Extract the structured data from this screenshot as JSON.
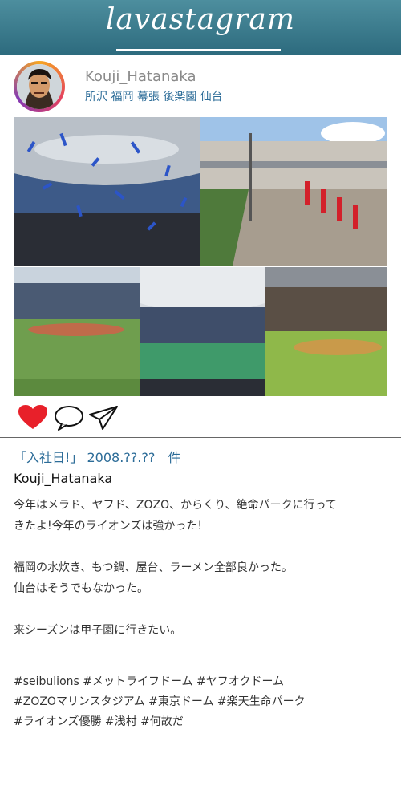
{
  "app": {
    "title": "lavastagram"
  },
  "profile": {
    "username": "Kouji_Hatanaka",
    "locations": "所沢 福岡 幕張 後楽園 仙台"
  },
  "post": {
    "title": "「入社日!」 2008.??.??　件",
    "author": "Kouji_Hatanaka",
    "caption_lines": [
      "今年はメラド、ヤフド、ZOZO、からくり、絶命パークに行って",
      "きたよ!今年のライオンズは強かった!",
      "福岡の水炊き、もつ鍋、屋台、ラーメン全部良かった。",
      "仙台はそうでもなかった。",
      "来シーズンは甲子園に行きたい。"
    ],
    "hashtag_lines": [
      "#seibulions #メットライフドーム #ヤフオクドーム",
      "#ZOZOマリンスタジアム #東京ドーム #楽天生命パーク",
      "#ライオンズ優勝 #浅村 #何故だ"
    ]
  },
  "icons": {
    "like": "heart-icon",
    "comment": "comment-icon",
    "share": "paper-plane-icon"
  },
  "colors": {
    "header": "#3a7b8d",
    "link": "#2c6c98",
    "like": "#e8202a"
  }
}
